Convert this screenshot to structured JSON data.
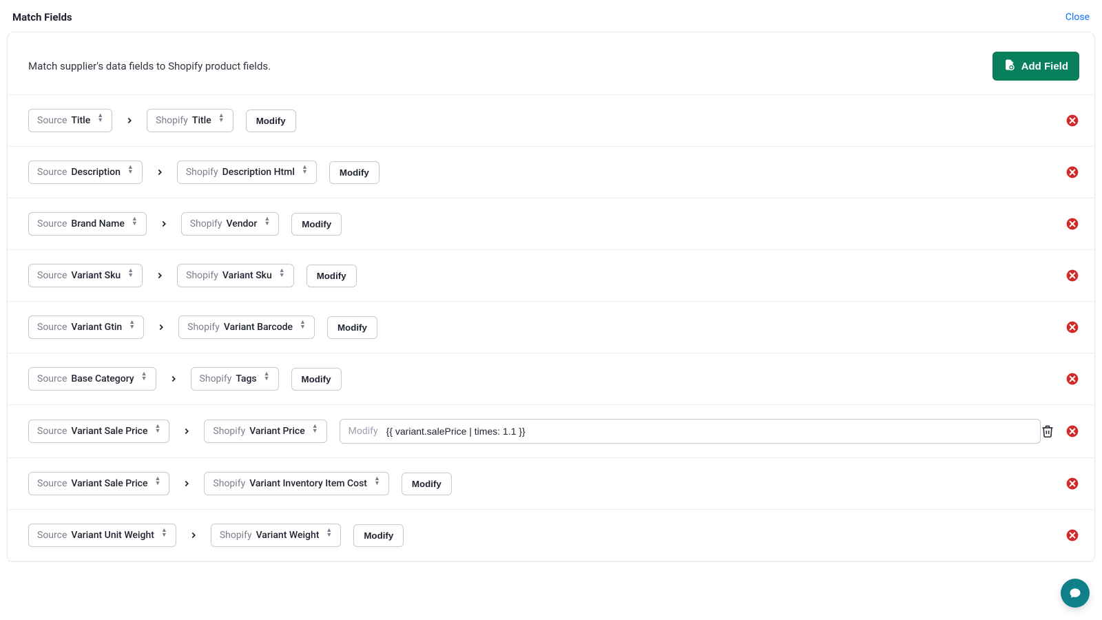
{
  "header": {
    "title": "Match Fields",
    "close": "Close"
  },
  "instruction": "Match supplier's data fields to Shopify product fields.",
  "addFieldLabel": "Add Field",
  "labels": {
    "sourcePrefix": "Source",
    "shopifyPrefix": "Shopify",
    "modify": "Modify"
  },
  "rows": [
    {
      "source": "Title",
      "target": "Title",
      "modifyType": "button"
    },
    {
      "source": "Description",
      "target": "Description Html",
      "modifyType": "button"
    },
    {
      "source": "Brand Name",
      "target": "Vendor",
      "modifyType": "button"
    },
    {
      "source": "Variant Sku",
      "target": "Variant Sku",
      "modifyType": "button"
    },
    {
      "source": "Variant Gtin",
      "target": "Variant Barcode",
      "modifyType": "button"
    },
    {
      "source": "Base Category",
      "target": "Tags",
      "modifyType": "button"
    },
    {
      "source": "Variant Sale Price",
      "target": "Variant Price",
      "modifyType": "input",
      "modifyValue": "{{ variant.salePrice | times: 1.1 }}",
      "hasTrash": true
    },
    {
      "source": "Variant Sale Price",
      "target": "Variant Inventory Item Cost",
      "modifyType": "button"
    },
    {
      "source": "Variant Unit Weight",
      "target": "Variant Weight",
      "modifyType": "button"
    }
  ]
}
